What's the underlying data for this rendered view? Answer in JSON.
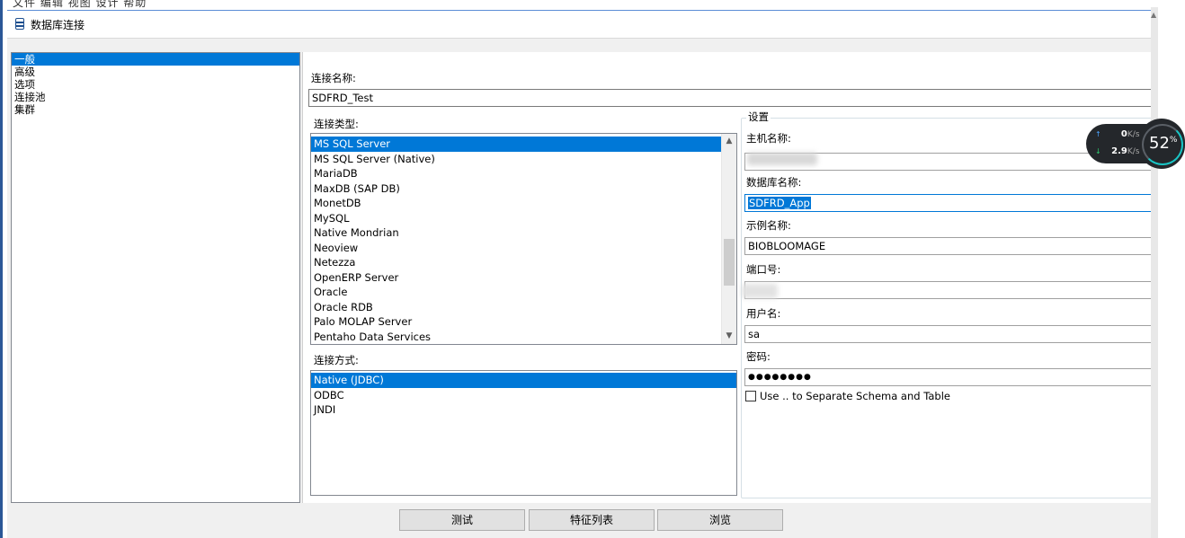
{
  "window": {
    "title": "数据库连接",
    "menu_ghost": "文件   编辑   视图   设计   帮助"
  },
  "nav": {
    "items": [
      "一般",
      "高级",
      "选项",
      "连接池",
      "集群"
    ],
    "selected_index": 0
  },
  "connection_name": {
    "label": "连接名称:",
    "value": "SDFRD_Test"
  },
  "connection_type": {
    "label": "连接类型:",
    "items": [
      "MS SQL Server",
      "MS SQL Server (Native)",
      "MariaDB",
      "MaxDB (SAP DB)",
      "MonetDB",
      "MySQL",
      "Native Mondrian",
      "Neoview",
      "Netezza",
      "OpenERP Server",
      "Oracle",
      "Oracle RDB",
      "Palo MOLAP Server",
      "Pentaho Data Services"
    ],
    "selected": "MS SQL Server"
  },
  "access": {
    "label": "连接方式:",
    "items": [
      "Native (JDBC)",
      "ODBC",
      "JNDI"
    ],
    "selected": "Native (JDBC)"
  },
  "settings": {
    "title": "设置",
    "host_label": "主机名称:",
    "host_value": "",
    "db_label": "数据库名称:",
    "db_value": "SDFRD_App",
    "instance_label": "示例名称:",
    "instance_value": "BIOBLOOMAGE",
    "port_label": "端口号:",
    "port_value": "",
    "user_label": "用户名:",
    "user_value": "sa",
    "password_label": "密码:",
    "password_value": "●●●●●●●●",
    "checkbox_label": "Use .. to Separate Schema and Table",
    "checkbox_checked": false
  },
  "buttons": {
    "test": "测试",
    "features": "特征列表",
    "explore": "浏览"
  },
  "net_widget": {
    "upload": "0",
    "upload_unit": "K/s",
    "download": "2.9",
    "download_unit": "K/s",
    "percent": "52",
    "percent_unit": "%"
  },
  "colors": {
    "selection": "#0078d7",
    "dialog_bg": "#f0f0f0",
    "widget_bg": "#24272b",
    "gauge_accent": "#19c5c5"
  }
}
